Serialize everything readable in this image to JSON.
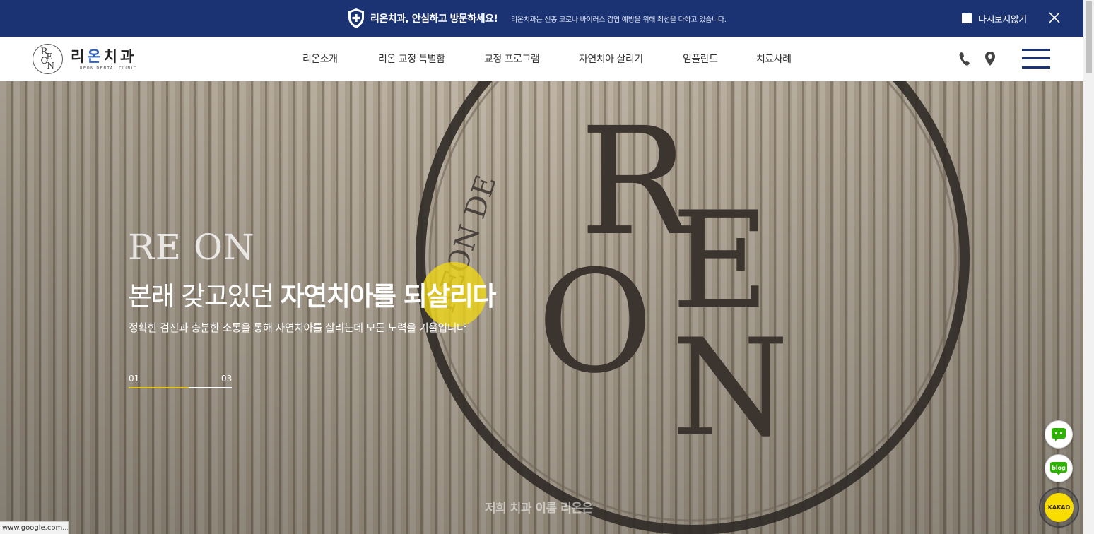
{
  "notice": {
    "title": "리온치과, 안심하고 방문하세요!",
    "description": "리온치과는 신종 코로나 바이러스 감염 예방을 위해 최선을 다하고 있습니다.",
    "dont_show_label": "다시보지않기",
    "background_color": "#1c3373",
    "icons": {
      "shield": "shield-plus-icon",
      "close": "close-icon"
    }
  },
  "header": {
    "logo": {
      "name_part1": "리",
      "name_part2": "온",
      "name_part3": "치과",
      "subtitle": "REON DENTAL CLINIC",
      "emblem_letters": [
        "R",
        "E",
        "O",
        "N"
      ]
    },
    "nav": [
      "리온소개",
      "리온 교정 특별함",
      "교정 프로그램",
      "자연치아 살리기",
      "임플란트",
      "치료사례"
    ],
    "icons": {
      "phone": "phone-icon",
      "location": "map-pin-icon",
      "menu": "hamburger-menu-icon"
    }
  },
  "hero": {
    "tag": "RE ON",
    "headline_light": "본래 갖고있던 ",
    "headline_bold": "자연치아를 되살리다",
    "subtext": "정확한 검진과 충분한 소통을 통해 자연치아를 살리는데 모든 노력을 기울입니다",
    "pager": {
      "current": "01",
      "total": "03",
      "progress": 0.58
    },
    "bottom_text": "저희 치과 이름 리온은",
    "background_letters": {
      "R": "R",
      "E": "E",
      "O": "O",
      "N": "N"
    },
    "background_arc_text": "REON DE",
    "accent_color": "#e8c51a"
  },
  "floating": {
    "chat_icon": "chat-bubble-icon",
    "blog_label": "blog",
    "kakao_label": "KAKAO"
  },
  "status_url": "www.google.com..."
}
